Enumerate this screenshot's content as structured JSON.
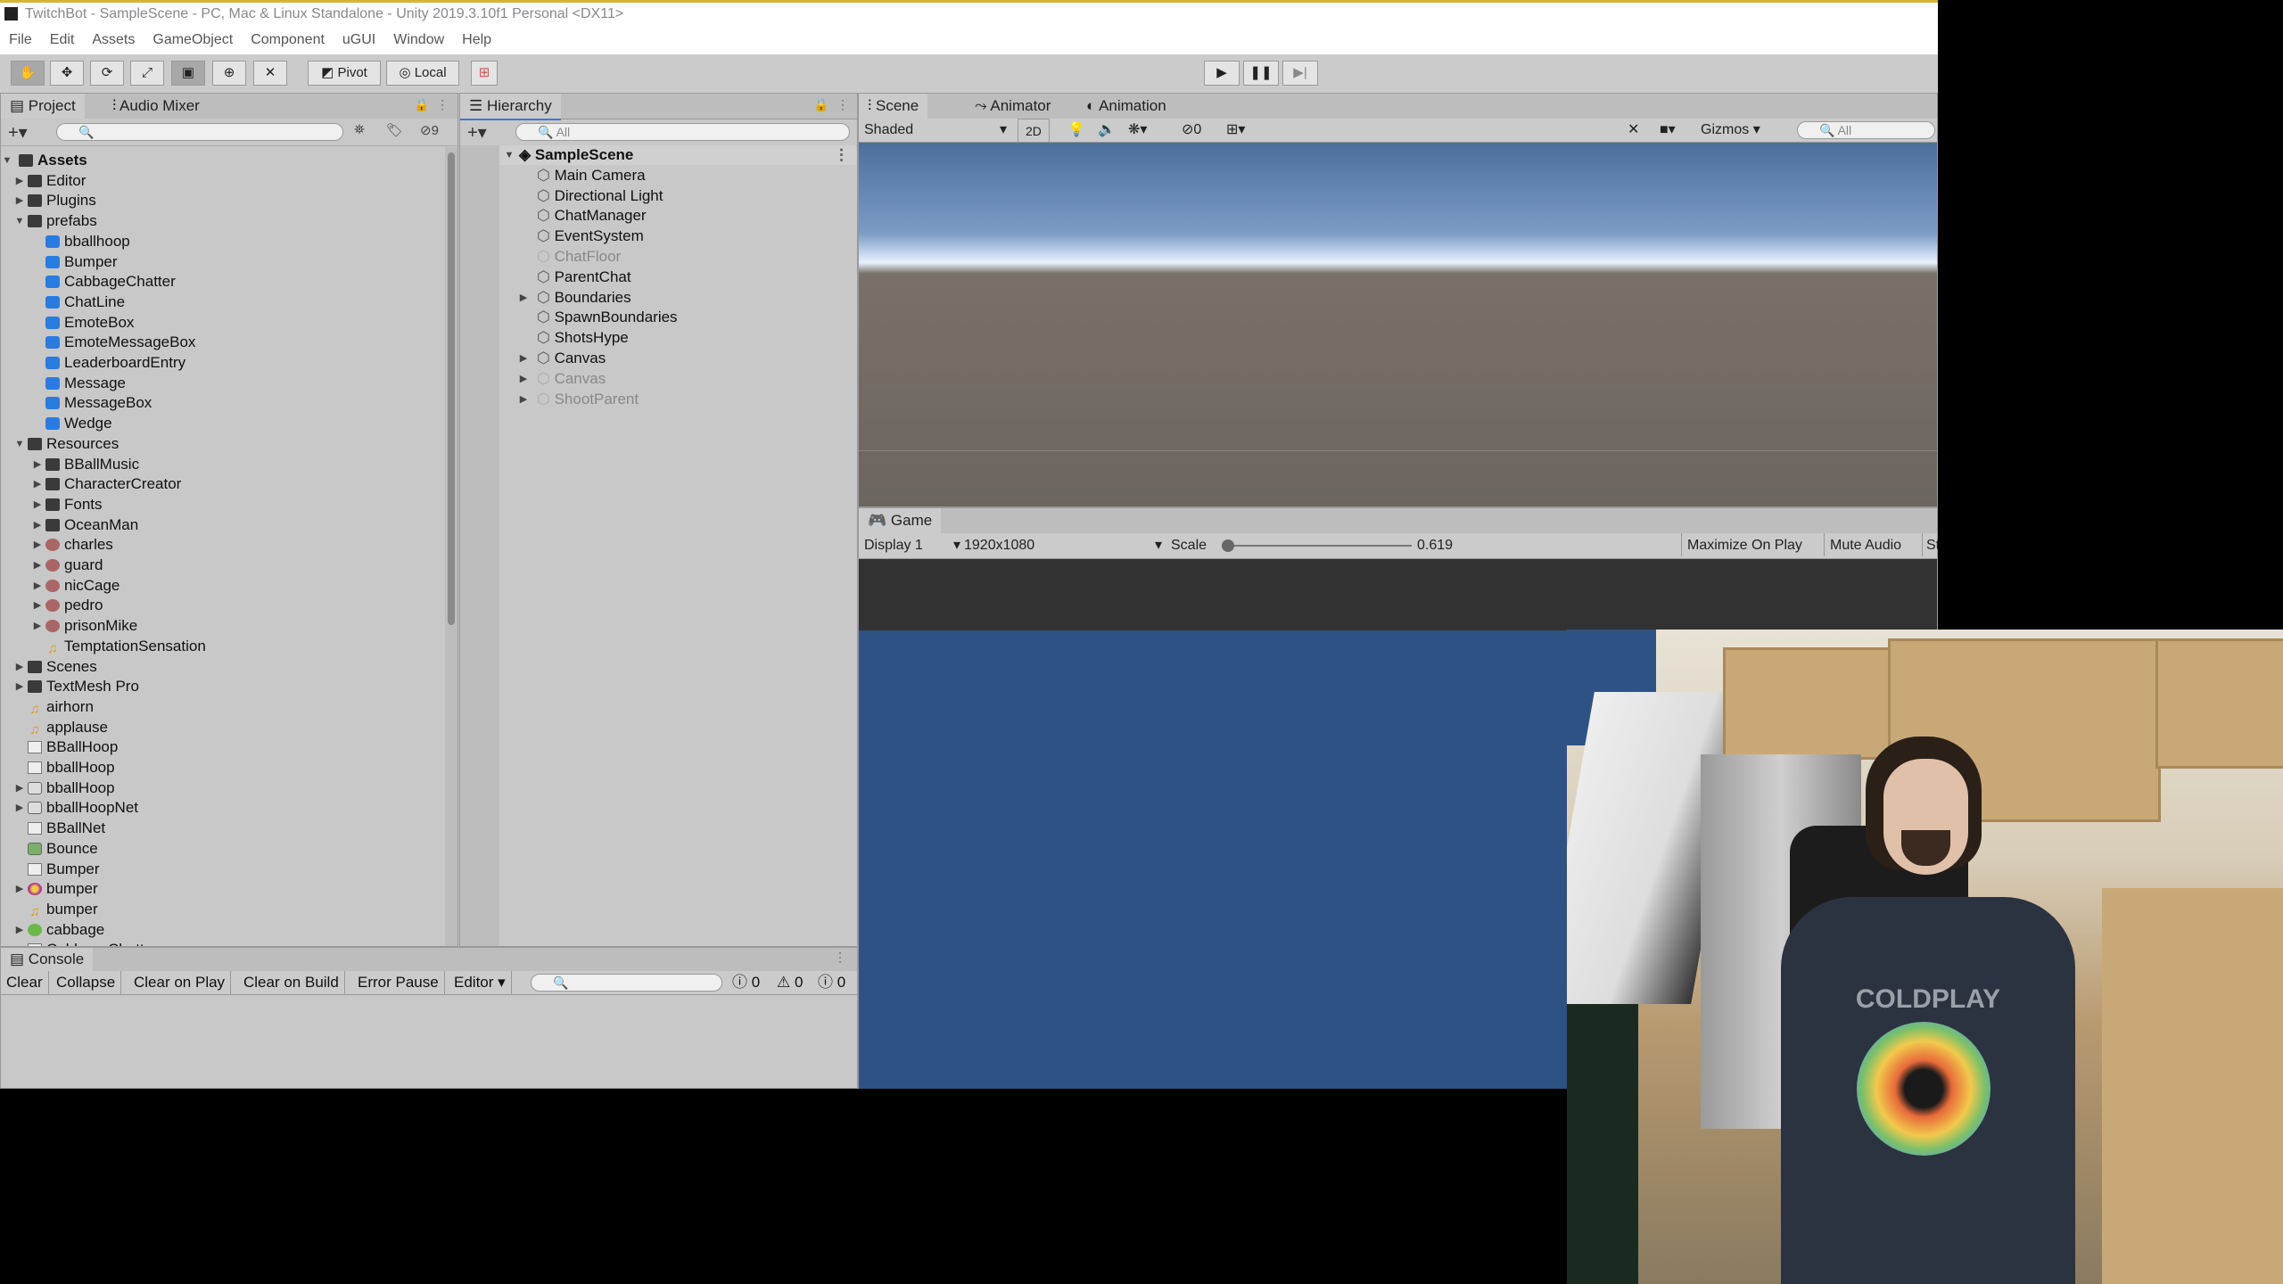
{
  "window": {
    "title": "TwitchBot - SampleScene - PC, Mac & Linux Standalone - Unity 2019.3.10f1 Personal <DX11>"
  },
  "menu": [
    "File",
    "Edit",
    "Assets",
    "GameObject",
    "Component",
    "uGUI",
    "Window",
    "Help"
  ],
  "toolbar": {
    "pivot_label": "Pivot",
    "local_label": "Local",
    "play_icon": "play-icon",
    "pause_icon": "pause-icon",
    "step_icon": "step-icon"
  },
  "project_panel": {
    "tabs": [
      "Project",
      "Audio Mixer"
    ],
    "hidden_count": "9",
    "root": "Assets",
    "items": [
      {
        "label": "Editor",
        "type": "folder",
        "depth": 1,
        "expand": "collapsed"
      },
      {
        "label": "Plugins",
        "type": "folder",
        "depth": 1,
        "expand": "collapsed"
      },
      {
        "label": "prefabs",
        "type": "folder",
        "depth": 1,
        "expand": "expanded"
      },
      {
        "label": "bballhoop",
        "type": "prefab",
        "depth": 2,
        "expand": "none"
      },
      {
        "label": "Bumper",
        "type": "prefab",
        "depth": 2,
        "expand": "none"
      },
      {
        "label": "CabbageChatter",
        "type": "prefab",
        "depth": 2,
        "expand": "none"
      },
      {
        "label": "ChatLine",
        "type": "prefab",
        "depth": 2,
        "expand": "none"
      },
      {
        "label": "EmoteBox",
        "type": "prefab",
        "depth": 2,
        "expand": "none"
      },
      {
        "label": "EmoteMessageBox",
        "type": "prefab",
        "depth": 2,
        "expand": "none"
      },
      {
        "label": "LeaderboardEntry",
        "type": "prefab",
        "depth": 2,
        "expand": "none"
      },
      {
        "label": "Message",
        "type": "prefab",
        "depth": 2,
        "expand": "none"
      },
      {
        "label": "MessageBox",
        "type": "prefab",
        "depth": 2,
        "expand": "none"
      },
      {
        "label": "Wedge",
        "type": "prefab",
        "depth": 2,
        "expand": "none"
      },
      {
        "label": "Resources",
        "type": "folder",
        "depth": 1,
        "expand": "expanded"
      },
      {
        "label": "BBallMusic",
        "type": "folder",
        "depth": 2,
        "expand": "collapsed"
      },
      {
        "label": "CharacterCreator",
        "type": "folder",
        "depth": 2,
        "expand": "collapsed"
      },
      {
        "label": "Fonts",
        "type": "folder",
        "depth": 2,
        "expand": "collapsed"
      },
      {
        "label": "OceanMan",
        "type": "folder",
        "depth": 2,
        "expand": "collapsed"
      },
      {
        "label": "charles",
        "type": "portrait",
        "depth": 2,
        "expand": "collapsed"
      },
      {
        "label": "guard",
        "type": "portrait",
        "depth": 2,
        "expand": "collapsed"
      },
      {
        "label": "nicCage",
        "type": "portrait",
        "depth": 2,
        "expand": "collapsed"
      },
      {
        "label": "pedro",
        "type": "portrait",
        "depth": 2,
        "expand": "collapsed"
      },
      {
        "label": "prisonMike",
        "type": "portrait",
        "depth": 2,
        "expand": "collapsed"
      },
      {
        "label": "TemptationSensation",
        "type": "audio",
        "depth": 2,
        "expand": "none"
      },
      {
        "label": "Scenes",
        "type": "folder",
        "depth": 1,
        "expand": "collapsed"
      },
      {
        "label": "TextMesh Pro",
        "type": "folder",
        "depth": 1,
        "expand": "collapsed"
      },
      {
        "label": "airhorn",
        "type": "audio",
        "depth": 1,
        "expand": "none"
      },
      {
        "label": "applause",
        "type": "audio",
        "depth": 1,
        "expand": "none"
      },
      {
        "label": "BBallHoop",
        "type": "script",
        "depth": 1,
        "expand": "none"
      },
      {
        "label": "bballHoop",
        "type": "script",
        "depth": 1,
        "expand": "none"
      },
      {
        "label": "bballHoop",
        "type": "model",
        "depth": 1,
        "expand": "collapsed"
      },
      {
        "label": "bballHoopNet",
        "type": "model",
        "depth": 1,
        "expand": "collapsed"
      },
      {
        "label": "BBallNet",
        "type": "script",
        "depth": 1,
        "expand": "none"
      },
      {
        "label": "Bounce",
        "type": "physics",
        "depth": 1,
        "expand": "none"
      },
      {
        "label": "Bumper",
        "type": "script",
        "depth": 1,
        "expand": "none"
      },
      {
        "label": "bumper",
        "type": "texture",
        "depth": 1,
        "expand": "collapsed"
      },
      {
        "label": "bumper",
        "type": "audio",
        "depth": 1,
        "expand": "none"
      },
      {
        "label": "cabbage",
        "type": "cabbage",
        "depth": 1,
        "expand": "collapsed"
      },
      {
        "label": "CabbageChatter",
        "type": "script",
        "depth": 1,
        "expand": "none"
      }
    ]
  },
  "hierarchy": {
    "tab": "Hierarchy",
    "search_placeholder": "All",
    "scene": "SampleScene",
    "items": [
      {
        "label": "Main Camera",
        "active": true,
        "has_children": false
      },
      {
        "label": "Directional Light",
        "active": true,
        "has_children": false
      },
      {
        "label": "ChatManager",
        "active": true,
        "has_children": false
      },
      {
        "label": "EventSystem",
        "active": true,
        "has_children": false
      },
      {
        "label": "ChatFloor",
        "active": false,
        "has_children": false
      },
      {
        "label": "ParentChat",
        "active": true,
        "has_children": false
      },
      {
        "label": "Boundaries",
        "active": true,
        "has_children": true
      },
      {
        "label": "SpawnBoundaries",
        "active": true,
        "has_children": false
      },
      {
        "label": "ShotsHype",
        "active": true,
        "has_children": false
      },
      {
        "label": "Canvas",
        "active": true,
        "has_children": true
      },
      {
        "label": "Canvas",
        "active": false,
        "has_children": true
      },
      {
        "label": "ShootParent",
        "active": false,
        "has_children": true
      }
    ]
  },
  "scene_view": {
    "tabs": [
      "Scene",
      "Animator",
      "Animation"
    ],
    "shading": "Shaded",
    "mode_2d": "2D",
    "hidden_count": "0",
    "gizmos": "Gizmos",
    "search_placeholder": "All"
  },
  "game_view": {
    "tab": "Game",
    "display": "Display 1",
    "resolution": "1920x1080",
    "scale_label": "Scale",
    "scale_value": "0.619",
    "scale_fraction": 0.02,
    "maximize": "Maximize On Play",
    "mute": "Mute Audio",
    "stats": "St"
  },
  "console": {
    "tab": "Console",
    "buttons": [
      "Clear",
      "Collapse",
      "Clear on Play",
      "Clear on Build",
      "Error Pause",
      "Editor"
    ],
    "info_count": "0",
    "warning_count": "0",
    "error_count": "0"
  },
  "webcam": {
    "shirt_text": "COLDPLAY"
  },
  "colors": {
    "accent": "#3a79d6",
    "game_bg": "#2e5283",
    "scene_ground": "#6b6560",
    "prefab_blue": "#2a7be0"
  }
}
